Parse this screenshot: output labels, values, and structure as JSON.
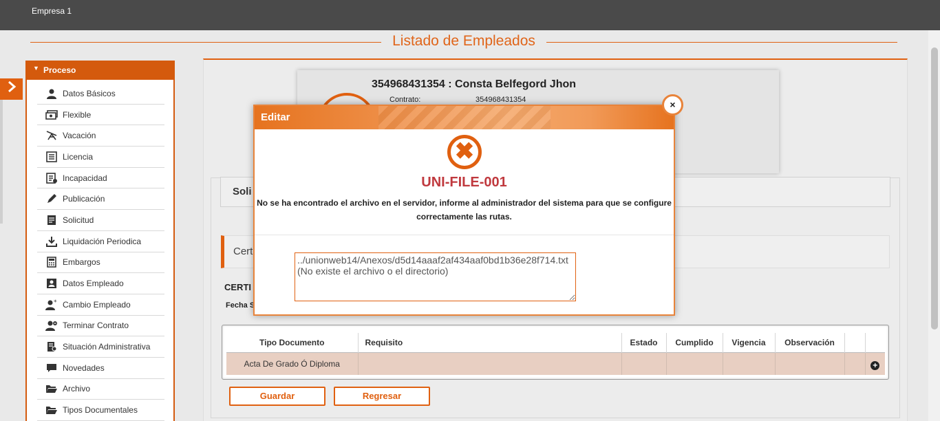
{
  "topbar": {
    "company": "Empresa 1"
  },
  "page": {
    "title": "Listado de Empleados"
  },
  "sidebar": {
    "header": "Proceso",
    "items": [
      {
        "label": "Datos Básicos",
        "icon": "user-icon"
      },
      {
        "label": "Flexible",
        "icon": "money-icon"
      },
      {
        "label": "Vacación",
        "icon": "beach-chair-icon"
      },
      {
        "label": "Licencia",
        "icon": "list-icon"
      },
      {
        "label": "Incapacidad",
        "icon": "medical-icon"
      },
      {
        "label": "Publicación",
        "icon": "pencil-icon"
      },
      {
        "label": "Solicitud",
        "icon": "document-icon"
      },
      {
        "label": "Liquidación Periodica",
        "icon": "download-icon"
      },
      {
        "label": "Embargos",
        "icon": "calculator-icon"
      },
      {
        "label": "Datos Empleado",
        "icon": "id-card-icon"
      },
      {
        "label": "Cambio Empleado",
        "icon": "user-star-icon"
      },
      {
        "label": "Terminar Contrato",
        "icon": "user-remove-icon"
      },
      {
        "label": "Situación Administrativa",
        "icon": "document-user-icon"
      },
      {
        "label": "Novedades",
        "icon": "chat-icon"
      },
      {
        "label": "Archivo",
        "icon": "folder-open-icon"
      },
      {
        "label": "Tipos Documentales",
        "icon": "folder-open-icon"
      }
    ]
  },
  "employee": {
    "name": "354968431354 : Consta Belfegord Jhon",
    "contract_label": "Contrato:",
    "contract_value": "354968431354"
  },
  "sections": {
    "solicitud_partial": "Soli",
    "cert_partial": "Cert",
    "certi_partial": "CERTI",
    "fecha_partial": "Fecha S"
  },
  "table": {
    "headers": [
      "Tipo Documento",
      "Requisito",
      "Estado",
      "Cumplido",
      "Vigencia",
      "Observación",
      "",
      ""
    ],
    "rows": [
      {
        "tipo": "Acta De Grado Ó Diploma",
        "requisito": "",
        "estado": "",
        "cumplido": "",
        "vigencia": "",
        "observacion": ""
      }
    ]
  },
  "buttons": {
    "guardar": "Guardar",
    "regresar": "Regresar"
  },
  "modal": {
    "title": "Editar",
    "error_code": "UNI-FILE-001",
    "message": "No se ha encontrado el archivo en el servidor, informe al administrador del sistema para que se configure correctamente las rutas.",
    "detail": "../unionweb14/Anexos/d5d14aaaf2af434aaf0bd1b36e28f714.txt\n(No existe el archivo o el directorio)",
    "close_symbol": "×"
  },
  "colors": {
    "accent": "#e06010",
    "error": "#c0393e",
    "topbar": "#4a4a4a"
  }
}
